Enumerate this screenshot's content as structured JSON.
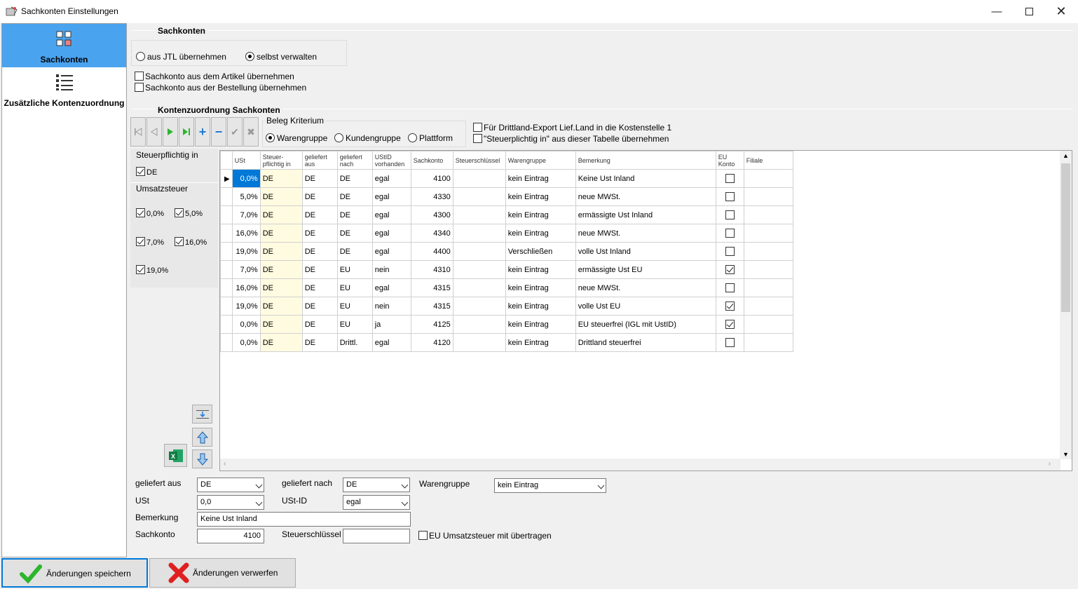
{
  "window": {
    "title": "Sachkonten Einstellungen"
  },
  "sidebar": {
    "items": [
      {
        "label": "Sachkonten"
      },
      {
        "label": "Zusätzliche Kontenzuordnung"
      }
    ]
  },
  "sachkonten": {
    "heading": "Sachkonten",
    "radio_jtl": "aus JTL übernehmen",
    "radio_selbst": "selbst verwalten",
    "cb_artikel": "Sachkonto aus dem Artikel übernehmen",
    "cb_bestellung": "Sachkonto aus der Bestellung übernehmen"
  },
  "zuordnung": {
    "heading": "Kontenzuordnung Sachkonten",
    "beleg_heading": "Beleg Kriterium",
    "beleg_options": [
      "Warengruppe",
      "Kundengruppe",
      "Plattform"
    ],
    "cb_drittland": "Für Drittland-Export Lief.Land in die Kostenstelle 1",
    "cb_steuerpflichtig": "\"Steuerplichtig in\" aus dieser Tabelle übernehmen"
  },
  "filter": {
    "steuerpflichtig_heading": "Steuerpflichtig in",
    "steuerpflichtig_de": "DE",
    "umsatz_heading": "Umsatzsteuer",
    "rates": [
      "0,0%",
      "5,0%",
      "7,0%",
      "16,0%",
      "19,0%"
    ]
  },
  "table": {
    "headers": [
      "USt",
      "Steuer-pflichtig in",
      "geliefert aus",
      "geliefert nach",
      "UStID vorhanden",
      "Sachkonto",
      "Steuerschlüssel",
      "Warengruppe",
      "Bemerkung",
      "EU Konto",
      "Filiale"
    ],
    "rows": [
      {
        "ust": "0,0%",
        "sp": "DE",
        "aus": "DE",
        "nach": "DE",
        "ustid": "egal",
        "konto": "4100",
        "schl": "",
        "wg": "kein Eintrag",
        "bem": "Keine Ust Inland",
        "eu": false
      },
      {
        "ust": "5,0%",
        "sp": "DE",
        "aus": "DE",
        "nach": "DE",
        "ustid": "egal",
        "konto": "4330",
        "schl": "",
        "wg": "kein Eintrag",
        "bem": "neue MWSt.",
        "eu": false
      },
      {
        "ust": "7,0%",
        "sp": "DE",
        "aus": "DE",
        "nach": "DE",
        "ustid": "egal",
        "konto": "4300",
        "schl": "",
        "wg": "kein Eintrag",
        "bem": "ermässigte Ust Inland",
        "eu": false
      },
      {
        "ust": "16,0%",
        "sp": "DE",
        "aus": "DE",
        "nach": "DE",
        "ustid": "egal",
        "konto": "4340",
        "schl": "",
        "wg": "kein Eintrag",
        "bem": "neue MWSt.",
        "eu": false
      },
      {
        "ust": "19,0%",
        "sp": "DE",
        "aus": "DE",
        "nach": "DE",
        "ustid": "egal",
        "konto": "4400",
        "schl": "",
        "wg": "Verschließen",
        "bem": "volle Ust Inland",
        "eu": false
      },
      {
        "ust": "7,0%",
        "sp": "DE",
        "aus": "DE",
        "nach": "EU",
        "ustid": "nein",
        "konto": "4310",
        "schl": "",
        "wg": "kein Eintrag",
        "bem": "ermässigte Ust EU",
        "eu": true
      },
      {
        "ust": "16,0%",
        "sp": "DE",
        "aus": "DE",
        "nach": "EU",
        "ustid": "egal",
        "konto": "4315",
        "schl": "",
        "wg": "kein Eintrag",
        "bem": "neue MWSt.",
        "eu": false
      },
      {
        "ust": "19,0%",
        "sp": "DE",
        "aus": "DE",
        "nach": "EU",
        "ustid": "nein",
        "konto": "4315",
        "schl": "",
        "wg": "kein Eintrag",
        "bem": "volle Ust EU",
        "eu": true
      },
      {
        "ust": "0,0%",
        "sp": "DE",
        "aus": "DE",
        "nach": "EU",
        "ustid": "ja",
        "konto": "4125",
        "schl": "",
        "wg": "kein Eintrag",
        "bem": "EU steuerfrei (IGL mit UstID)",
        "eu": true
      },
      {
        "ust": "0,0%",
        "sp": "DE",
        "aus": "DE",
        "nach": "Drittl.",
        "ustid": "egal",
        "konto": "4120",
        "schl": "",
        "wg": "kein Eintrag",
        "bem": "Drittland steuerfrei",
        "eu": false
      }
    ]
  },
  "form": {
    "geliefert_aus_label": "geliefert aus",
    "geliefert_aus_value": "DE",
    "geliefert_nach_label": "geliefert nach",
    "geliefert_nach_value": "DE",
    "warengruppe_label": "Warengruppe",
    "warengruppe_value": "kein Eintrag",
    "ust_label": "USt",
    "ust_value": "0,0",
    "ustid_label": "USt-ID",
    "ustid_value": "egal",
    "bemerkung_label": "Bemerkung",
    "bemerkung_value": "Keine Ust Inland",
    "sachkonto_label": "Sachkonto",
    "sachkonto_value": "4100",
    "steuerschluessel_label": "Steuerschlüssel",
    "steuerschluessel_value": "",
    "eu_umsatz_label": "EU Umsatzsteuer mit übertragen"
  },
  "footer": {
    "save": "Änderungen speichern",
    "discard": "Änderungen verwerfen"
  },
  "colors": {
    "accent": "#4aa3ef",
    "selected": "#0078d7",
    "highlight": "#fffbe0",
    "green": "#2db52d",
    "red": "#e02020"
  }
}
